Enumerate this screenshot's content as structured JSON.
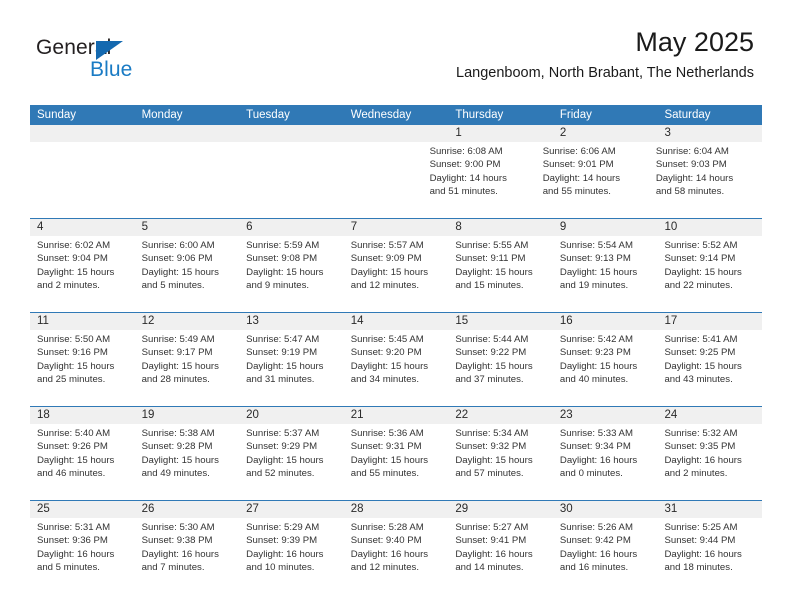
{
  "brand": {
    "name_primary": "General",
    "name_secondary": "Blue",
    "triangle_color": "#1469b0",
    "blue_color": "#1a7bc4"
  },
  "header": {
    "month_title": "May 2025",
    "location": "Langenboom, North Brabant, The Netherlands"
  },
  "theme": {
    "header_blue": "#3079b6",
    "daynum_band": "#f0f0f0",
    "text": "#333333"
  },
  "weekdays": [
    "Sunday",
    "Monday",
    "Tuesday",
    "Wednesday",
    "Thursday",
    "Friday",
    "Saturday"
  ],
  "weeks": [
    {
      "days": [
        {
          "empty": true
        },
        {
          "empty": true
        },
        {
          "empty": true
        },
        {
          "empty": true
        },
        {
          "empty": false,
          "num": "1",
          "sunrise": "Sunrise: 6:08 AM",
          "sunset": "Sunset: 9:00 PM",
          "daylight_1": "Daylight: 14 hours",
          "daylight_2": "and 51 minutes."
        },
        {
          "empty": false,
          "num": "2",
          "sunrise": "Sunrise: 6:06 AM",
          "sunset": "Sunset: 9:01 PM",
          "daylight_1": "Daylight: 14 hours",
          "daylight_2": "and 55 minutes."
        },
        {
          "empty": false,
          "num": "3",
          "sunrise": "Sunrise: 6:04 AM",
          "sunset": "Sunset: 9:03 PM",
          "daylight_1": "Daylight: 14 hours",
          "daylight_2": "and 58 minutes."
        }
      ]
    },
    {
      "days": [
        {
          "empty": false,
          "num": "4",
          "sunrise": "Sunrise: 6:02 AM",
          "sunset": "Sunset: 9:04 PM",
          "daylight_1": "Daylight: 15 hours",
          "daylight_2": "and 2 minutes."
        },
        {
          "empty": false,
          "num": "5",
          "sunrise": "Sunrise: 6:00 AM",
          "sunset": "Sunset: 9:06 PM",
          "daylight_1": "Daylight: 15 hours",
          "daylight_2": "and 5 minutes."
        },
        {
          "empty": false,
          "num": "6",
          "sunrise": "Sunrise: 5:59 AM",
          "sunset": "Sunset: 9:08 PM",
          "daylight_1": "Daylight: 15 hours",
          "daylight_2": "and 9 minutes."
        },
        {
          "empty": false,
          "num": "7",
          "sunrise": "Sunrise: 5:57 AM",
          "sunset": "Sunset: 9:09 PM",
          "daylight_1": "Daylight: 15 hours",
          "daylight_2": "and 12 minutes."
        },
        {
          "empty": false,
          "num": "8",
          "sunrise": "Sunrise: 5:55 AM",
          "sunset": "Sunset: 9:11 PM",
          "daylight_1": "Daylight: 15 hours",
          "daylight_2": "and 15 minutes."
        },
        {
          "empty": false,
          "num": "9",
          "sunrise": "Sunrise: 5:54 AM",
          "sunset": "Sunset: 9:13 PM",
          "daylight_1": "Daylight: 15 hours",
          "daylight_2": "and 19 minutes."
        },
        {
          "empty": false,
          "num": "10",
          "sunrise": "Sunrise: 5:52 AM",
          "sunset": "Sunset: 9:14 PM",
          "daylight_1": "Daylight: 15 hours",
          "daylight_2": "and 22 minutes."
        }
      ]
    },
    {
      "days": [
        {
          "empty": false,
          "num": "11",
          "sunrise": "Sunrise: 5:50 AM",
          "sunset": "Sunset: 9:16 PM",
          "daylight_1": "Daylight: 15 hours",
          "daylight_2": "and 25 minutes."
        },
        {
          "empty": false,
          "num": "12",
          "sunrise": "Sunrise: 5:49 AM",
          "sunset": "Sunset: 9:17 PM",
          "daylight_1": "Daylight: 15 hours",
          "daylight_2": "and 28 minutes."
        },
        {
          "empty": false,
          "num": "13",
          "sunrise": "Sunrise: 5:47 AM",
          "sunset": "Sunset: 9:19 PM",
          "daylight_1": "Daylight: 15 hours",
          "daylight_2": "and 31 minutes."
        },
        {
          "empty": false,
          "num": "14",
          "sunrise": "Sunrise: 5:45 AM",
          "sunset": "Sunset: 9:20 PM",
          "daylight_1": "Daylight: 15 hours",
          "daylight_2": "and 34 minutes."
        },
        {
          "empty": false,
          "num": "15",
          "sunrise": "Sunrise: 5:44 AM",
          "sunset": "Sunset: 9:22 PM",
          "daylight_1": "Daylight: 15 hours",
          "daylight_2": "and 37 minutes."
        },
        {
          "empty": false,
          "num": "16",
          "sunrise": "Sunrise: 5:42 AM",
          "sunset": "Sunset: 9:23 PM",
          "daylight_1": "Daylight: 15 hours",
          "daylight_2": "and 40 minutes."
        },
        {
          "empty": false,
          "num": "17",
          "sunrise": "Sunrise: 5:41 AM",
          "sunset": "Sunset: 9:25 PM",
          "daylight_1": "Daylight: 15 hours",
          "daylight_2": "and 43 minutes."
        }
      ]
    },
    {
      "days": [
        {
          "empty": false,
          "num": "18",
          "sunrise": "Sunrise: 5:40 AM",
          "sunset": "Sunset: 9:26 PM",
          "daylight_1": "Daylight: 15 hours",
          "daylight_2": "and 46 minutes."
        },
        {
          "empty": false,
          "num": "19",
          "sunrise": "Sunrise: 5:38 AM",
          "sunset": "Sunset: 9:28 PM",
          "daylight_1": "Daylight: 15 hours",
          "daylight_2": "and 49 minutes."
        },
        {
          "empty": false,
          "num": "20",
          "sunrise": "Sunrise: 5:37 AM",
          "sunset": "Sunset: 9:29 PM",
          "daylight_1": "Daylight: 15 hours",
          "daylight_2": "and 52 minutes."
        },
        {
          "empty": false,
          "num": "21",
          "sunrise": "Sunrise: 5:36 AM",
          "sunset": "Sunset: 9:31 PM",
          "daylight_1": "Daylight: 15 hours",
          "daylight_2": "and 55 minutes."
        },
        {
          "empty": false,
          "num": "22",
          "sunrise": "Sunrise: 5:34 AM",
          "sunset": "Sunset: 9:32 PM",
          "daylight_1": "Daylight: 15 hours",
          "daylight_2": "and 57 minutes."
        },
        {
          "empty": false,
          "num": "23",
          "sunrise": "Sunrise: 5:33 AM",
          "sunset": "Sunset: 9:34 PM",
          "daylight_1": "Daylight: 16 hours",
          "daylight_2": "and 0 minutes."
        },
        {
          "empty": false,
          "num": "24",
          "sunrise": "Sunrise: 5:32 AM",
          "sunset": "Sunset: 9:35 PM",
          "daylight_1": "Daylight: 16 hours",
          "daylight_2": "and 2 minutes."
        }
      ]
    },
    {
      "days": [
        {
          "empty": false,
          "num": "25",
          "sunrise": "Sunrise: 5:31 AM",
          "sunset": "Sunset: 9:36 PM",
          "daylight_1": "Daylight: 16 hours",
          "daylight_2": "and 5 minutes."
        },
        {
          "empty": false,
          "num": "26",
          "sunrise": "Sunrise: 5:30 AM",
          "sunset": "Sunset: 9:38 PM",
          "daylight_1": "Daylight: 16 hours",
          "daylight_2": "and 7 minutes."
        },
        {
          "empty": false,
          "num": "27",
          "sunrise": "Sunrise: 5:29 AM",
          "sunset": "Sunset: 9:39 PM",
          "daylight_1": "Daylight: 16 hours",
          "daylight_2": "and 10 minutes."
        },
        {
          "empty": false,
          "num": "28",
          "sunrise": "Sunrise: 5:28 AM",
          "sunset": "Sunset: 9:40 PM",
          "daylight_1": "Daylight: 16 hours",
          "daylight_2": "and 12 minutes."
        },
        {
          "empty": false,
          "num": "29",
          "sunrise": "Sunrise: 5:27 AM",
          "sunset": "Sunset: 9:41 PM",
          "daylight_1": "Daylight: 16 hours",
          "daylight_2": "and 14 minutes."
        },
        {
          "empty": false,
          "num": "30",
          "sunrise": "Sunrise: 5:26 AM",
          "sunset": "Sunset: 9:42 PM",
          "daylight_1": "Daylight: 16 hours",
          "daylight_2": "and 16 minutes."
        },
        {
          "empty": false,
          "num": "31",
          "sunrise": "Sunrise: 5:25 AM",
          "sunset": "Sunset: 9:44 PM",
          "daylight_1": "Daylight: 16 hours",
          "daylight_2": "and 18 minutes."
        }
      ]
    }
  ]
}
